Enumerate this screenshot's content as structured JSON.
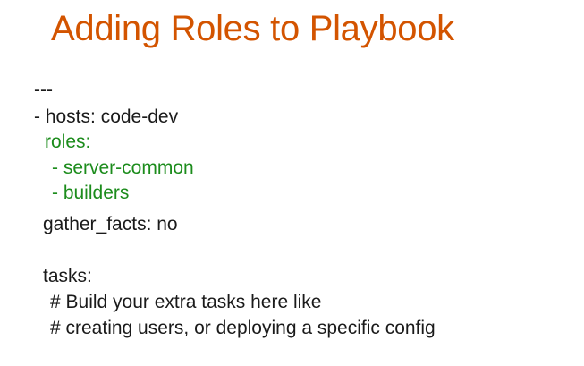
{
  "slide": {
    "title": "Adding Roles to Playbook",
    "colors": {
      "title": "#d35400",
      "text": "#1a1a1a",
      "roles": "#1c8c1c",
      "background": "#ffffff"
    },
    "lines": [
      {
        "text": "---",
        "style": "text"
      },
      {
        "text": "- hosts: code-dev",
        "style": "text"
      },
      {
        "text": "roles:",
        "style": "roles"
      },
      {
        "text": "- server-common",
        "style": "roles"
      },
      {
        "text": "- builders",
        "style": "roles"
      },
      {
        "text": "gather_facts: no",
        "style": "text"
      },
      {
        "text": "tasks:",
        "style": "text"
      },
      {
        "text": "# Build your extra tasks here like",
        "style": "text"
      },
      {
        "text": "# creating users, or deploying a specific config",
        "style": "text"
      }
    ]
  }
}
